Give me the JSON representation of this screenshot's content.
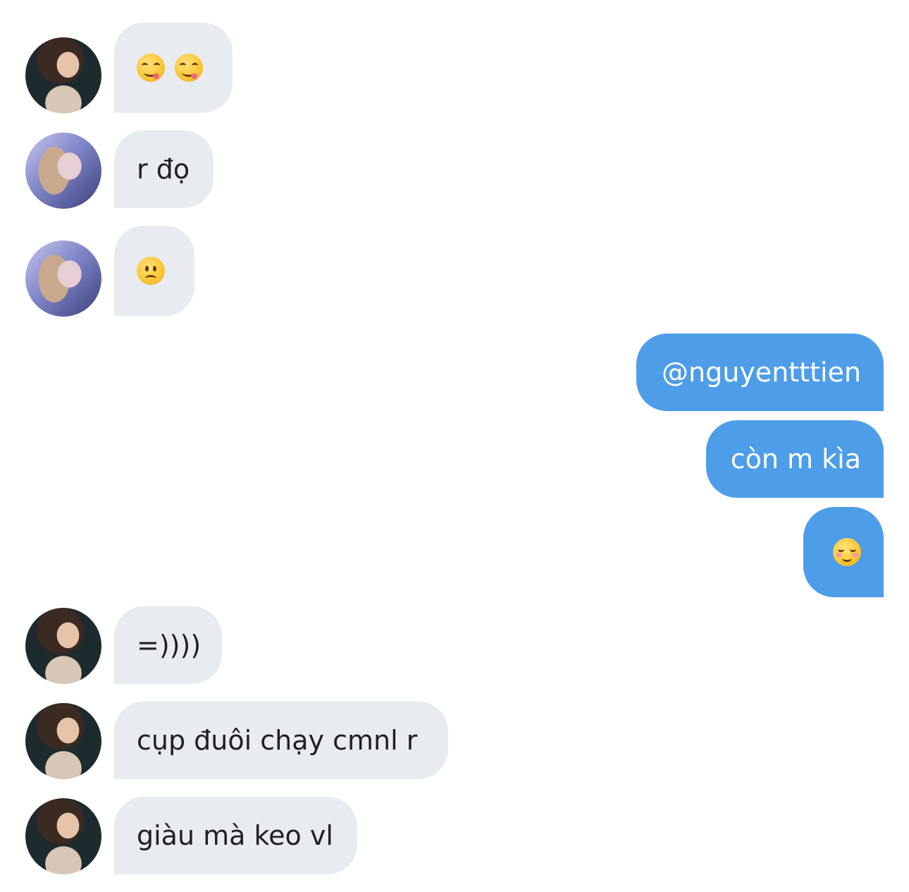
{
  "conversation": {
    "messages": [
      {
        "direction": "incoming",
        "avatar": "avatar-photo-a",
        "text": "😋 😋",
        "emoji_names": [
          "yum-face-icon",
          "yum-face-icon"
        ]
      },
      {
        "direction": "incoming",
        "avatar": "avatar-photo-b",
        "text": "r đọ"
      },
      {
        "direction": "incoming",
        "avatar": "avatar-photo-b",
        "text": "🙁",
        "emoji_names": [
          "slightly-frowning-face-icon"
        ]
      },
      {
        "direction": "outgoing",
        "text": "@nguyentttien"
      },
      {
        "direction": "outgoing",
        "text": "còn m kìa"
      },
      {
        "direction": "outgoing",
        "text": "☺️",
        "emoji_names": [
          "smiling-face-icon"
        ]
      },
      {
        "direction": "incoming",
        "avatar": "avatar-photo-a",
        "text": "=))))"
      },
      {
        "direction": "incoming",
        "avatar": "avatar-photo-a",
        "text": "cụp đuôi chạy cmnl r"
      },
      {
        "direction": "incoming",
        "avatar": "avatar-photo-a",
        "text": "giàu mà keo vl"
      }
    ]
  },
  "colors": {
    "incoming_bubble": "#e8ebf0",
    "outgoing_bubble": "#4d9de9",
    "incoming_text": "#1f1f24",
    "outgoing_text": "#ffffff",
    "background": "#ffffff"
  }
}
